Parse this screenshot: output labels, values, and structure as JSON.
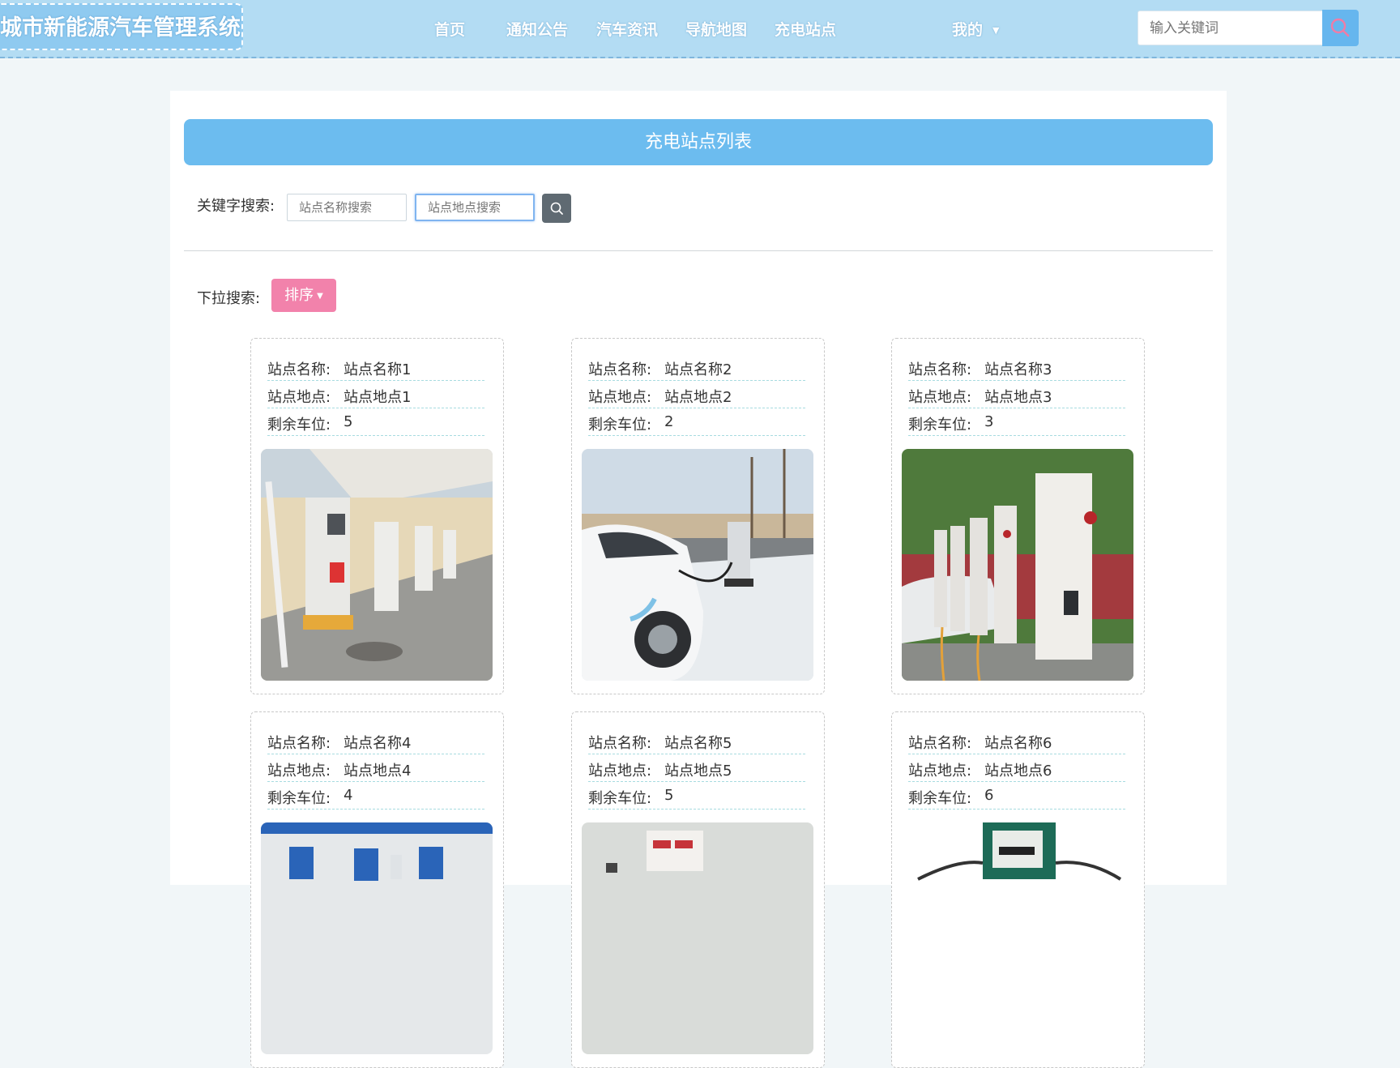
{
  "header": {
    "logo": "城市新能源汽车管理系统",
    "nav": [
      "首页",
      "通知公告",
      "汽车资讯",
      "导航地图",
      "充电站点"
    ],
    "user_menu": "我的",
    "search_placeholder": "输入关键词"
  },
  "page": {
    "title": "充电站点列表",
    "keyword_label": "关键字搜索:",
    "name_search_placeholder": "站点名称搜索",
    "location_search_placeholder": "站点地点搜索",
    "dropdown_label": "下拉搜索:",
    "sort_label": "排序"
  },
  "field_labels": {
    "name": "站点名称:",
    "location": "站点地点:",
    "spaces": "剩余车位:"
  },
  "stations": [
    {
      "name": "站点名称1",
      "location": "站点地点1",
      "spaces": "5"
    },
    {
      "name": "站点名称2",
      "location": "站点地点2",
      "spaces": "2"
    },
    {
      "name": "站点名称3",
      "location": "站点地点3",
      "spaces": "3"
    },
    {
      "name": "站点名称4",
      "location": "站点地点4",
      "spaces": "4"
    },
    {
      "name": "站点名称5",
      "location": "站点地点5",
      "spaces": "5"
    },
    {
      "name": "站点名称6",
      "location": "站点地点6",
      "spaces": "6"
    }
  ],
  "colors": {
    "header_bg": "#b3dcf3",
    "title_bar": "#6cbcef",
    "sort_button": "#f282ab",
    "search_button": "#66b6ee"
  },
  "icons": {
    "top_search": "search-icon",
    "keyword_search": "search-icon",
    "user_menu": "chevron-down-icon"
  }
}
